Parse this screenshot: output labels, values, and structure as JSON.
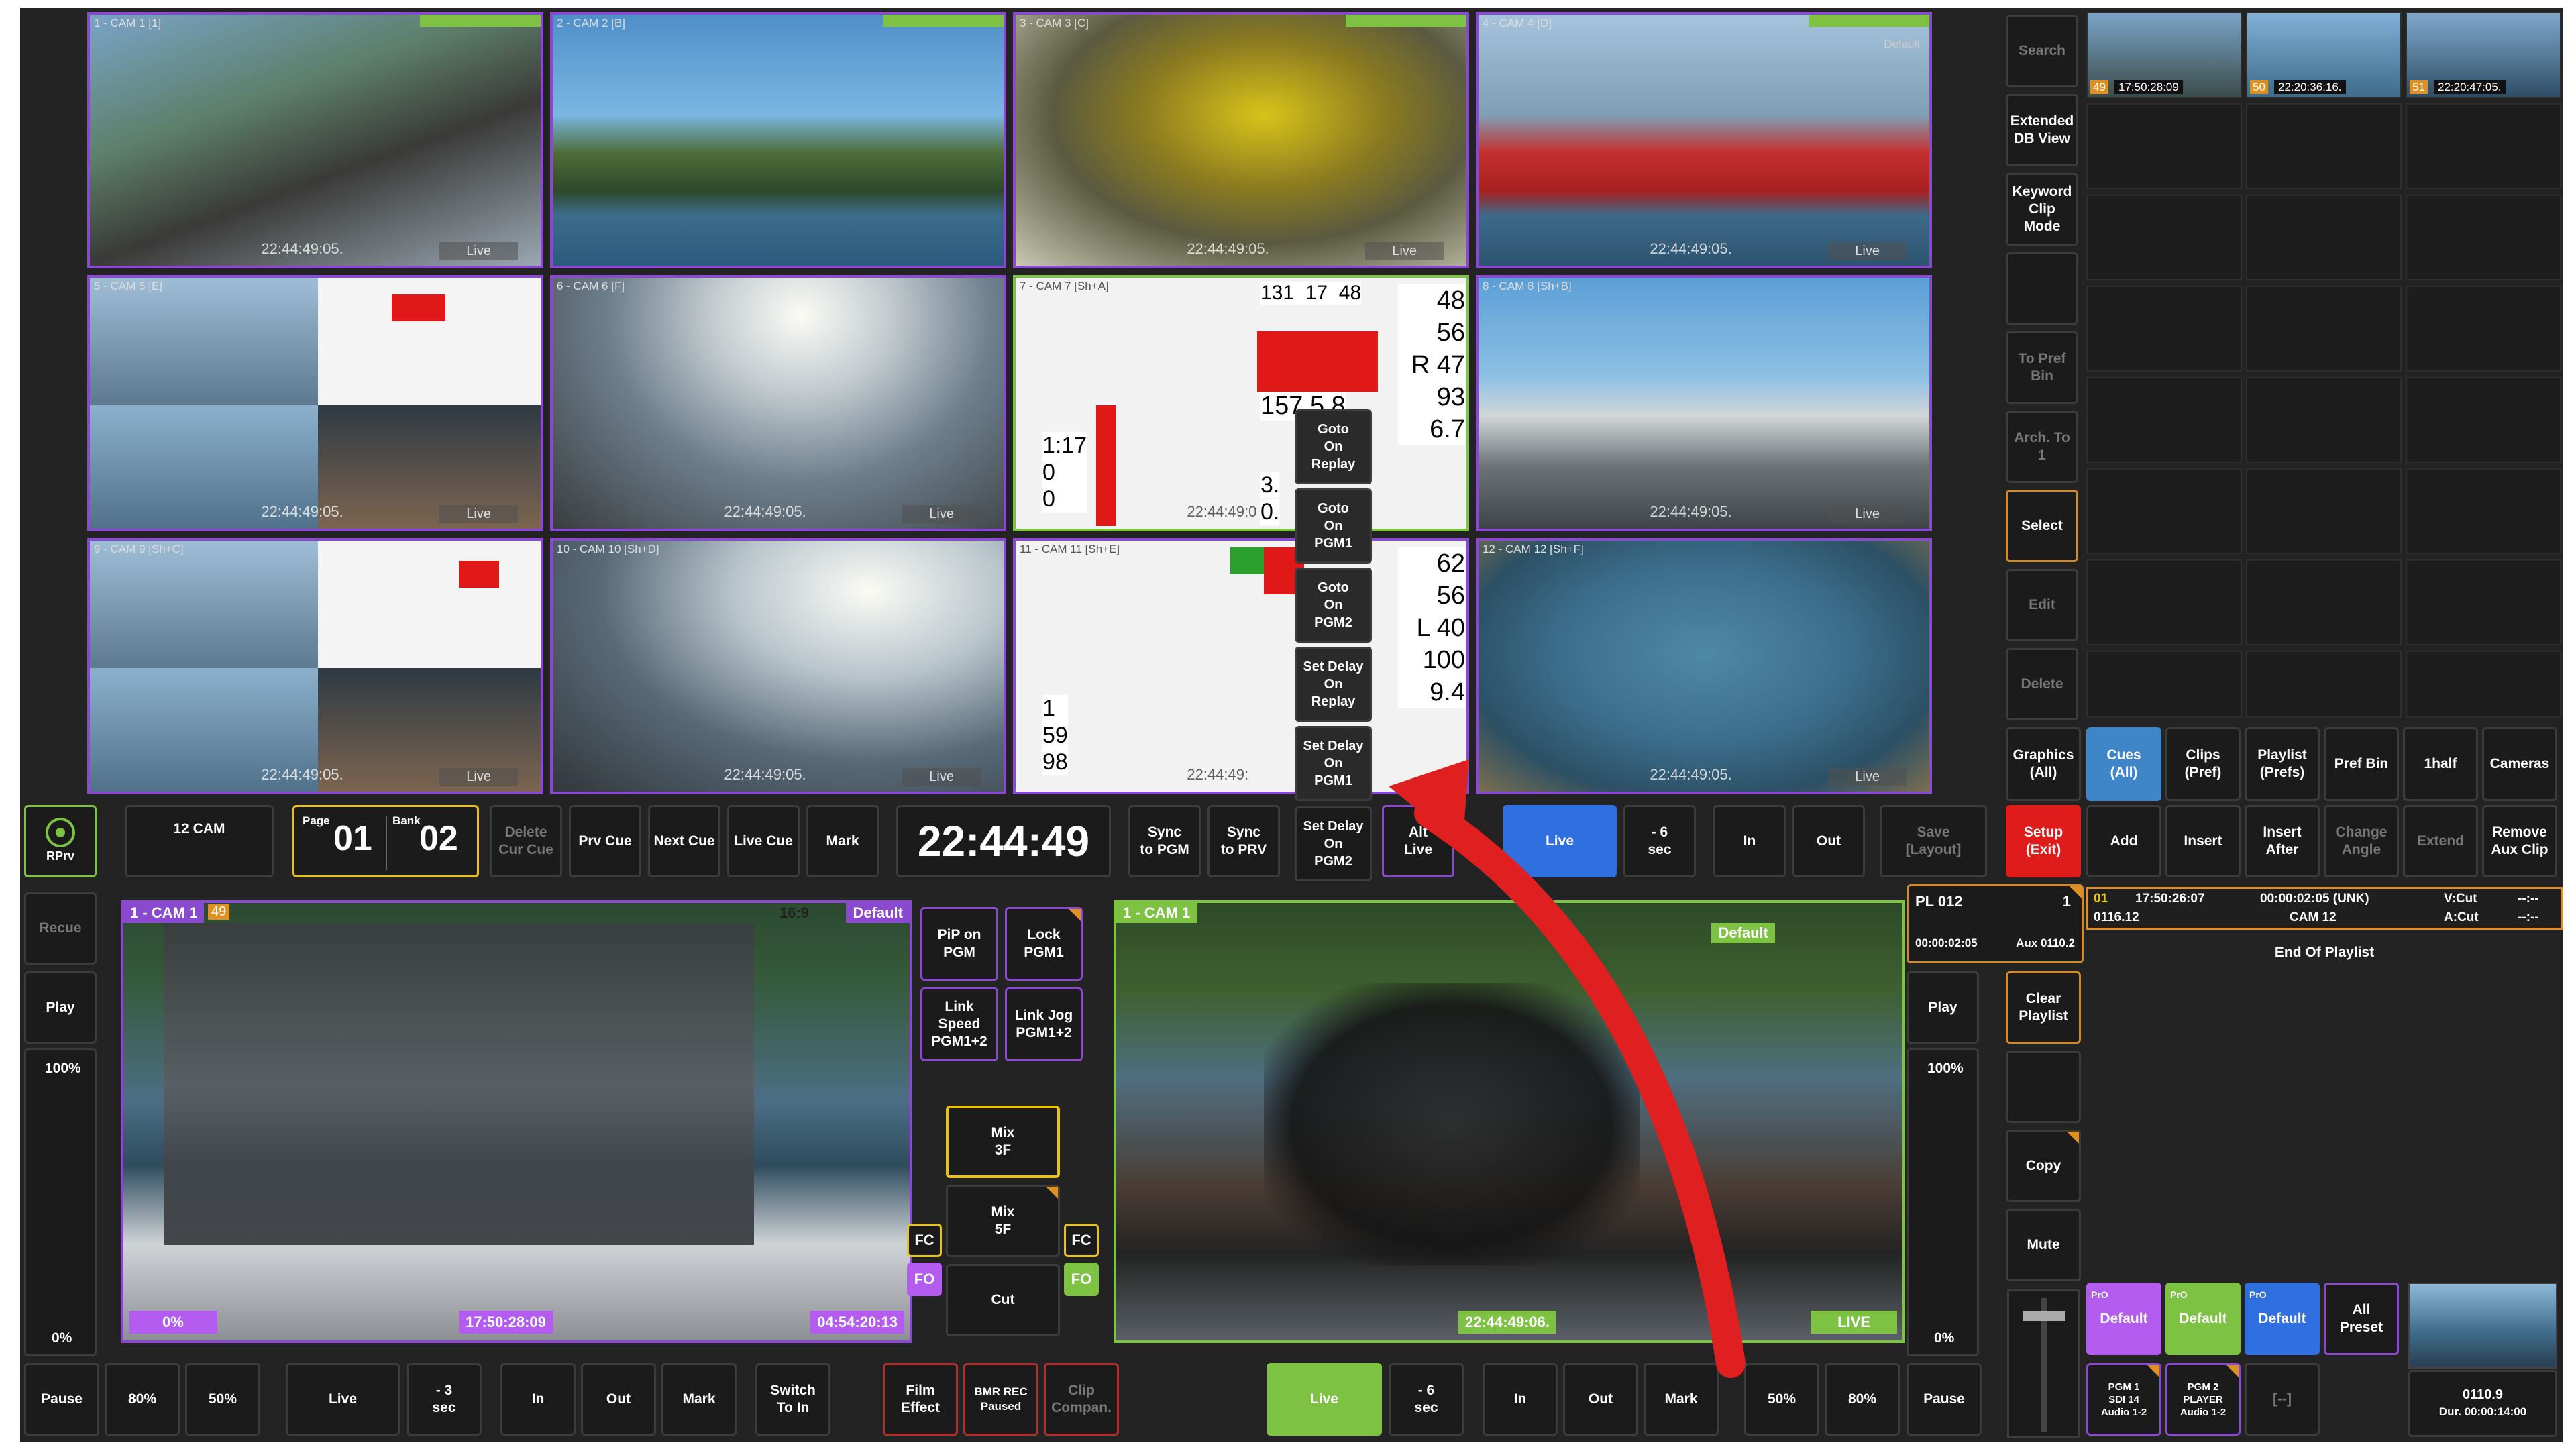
{
  "tiles": [
    {
      "tag": "1 - CAM 1 [1]",
      "tc": "22:44:49:05.",
      "live": "Live"
    },
    {
      "tag": "2 - CAM 2 [B]",
      "tc": "",
      "live": ""
    },
    {
      "tag": "3 - CAM 3 [C]",
      "tc": "22:44:49:05.",
      "live": "Live"
    },
    {
      "tag": "4 - CAM 4 [D]",
      "tc": "22:44:49:05.",
      "live": "Live",
      "preset": "Default"
    },
    {
      "tag": "5 - CAM 5 [E]",
      "tc": "22:44:49:05.",
      "live": "Live"
    },
    {
      "tag": "6 - CAM 6 [F]",
      "tc": "22:44:49:05.",
      "live": "Live"
    },
    {
      "tag": "7 - CAM 7 [Sh+A]",
      "tc": "22:44:49:0",
      "live": ""
    },
    {
      "tag": "8 - CAM 8 [Sh+B]",
      "tc": "22:44:49:05.",
      "live": "Live"
    },
    {
      "tag": "9 - CAM 9 [Sh+C]",
      "tc": "22:44:49:05.",
      "live": "Live"
    },
    {
      "tag": "10 - CAM 10 [Sh+D]",
      "tc": "22:44:49:05.",
      "live": "Live"
    },
    {
      "tag": "11 - CAM 11 [Sh+E]",
      "tc": "22:44:49:",
      "live": ""
    },
    {
      "tag": "12 - CAM 12 [Sh+F]",
      "tc": "22:44:49:05.",
      "live": "Live"
    }
  ],
  "overlay_numbers": {
    "top": [
      "131",
      "17",
      "48"
    ],
    "right": [
      "48",
      "56",
      "R 47",
      "93",
      "6.7",
      "62",
      "56",
      "L 40",
      "100",
      "9.4"
    ],
    "left": [
      "1:17",
      "0",
      "0",
      "1",
      "59",
      "98"
    ],
    "mid": [
      "157",
      "5.8",
      "3.",
      "0."
    ]
  },
  "context_menu": [
    "Goto\nOn\nReplay",
    "Goto\nOn\nPGM1",
    "Goto\nOn\nPGM2",
    "Set Delay\nOn\nReplay",
    "Set Delay\nOn\nPGM1",
    "Set Delay\nOn\nPGM2"
  ],
  "right_top": {
    "search": "Search",
    "ext_db": "Extended\nDB View",
    "keyword": "Keyword\nClip\nMode",
    "to_pref": "To Pref\nBin",
    "arch": "Arch. To\n1",
    "select": "Select",
    "edit": "Edit",
    "delete": "Delete"
  },
  "thumbs": [
    {
      "num": "49",
      "tc": "17:50:28:09"
    },
    {
      "num": "50",
      "tc": "22:20:36:16."
    },
    {
      "num": "51",
      "tc": "22:20:47:05."
    }
  ],
  "bin_tabs": [
    "Graphics\n(All)",
    "Cues\n(All)",
    "Clips\n(Pref)",
    "Playlist\n(Prefs)",
    "Pref Bin",
    "1half",
    "Cameras"
  ],
  "control_row": {
    "rprv": "RPrv",
    "cam": "12 CAM",
    "page_label": "Page",
    "page": "01",
    "bank_label": "Bank",
    "bank": "02",
    "delete_cue": "Delete\nCur Cue",
    "prv_cue": "Prv Cue",
    "next_cue": "Next Cue",
    "live_cue": "Live Cue",
    "mark": "Mark",
    "clock": "22:44:49",
    "sync_pgm": "Sync\nto PGM",
    "sync_prv": "Sync\nto PRV",
    "alt_live": "Alt\nLive",
    "live": "Live",
    "minus6": "- 6\nsec",
    "in": "In",
    "out": "Out",
    "save_layout": "Save\n[Layout]",
    "setup": "Setup\n(Exit)",
    "add": "Add",
    "insert": "Insert",
    "insert_after": "Insert\nAfter",
    "change_angle": "Change\nAngle",
    "extend": "Extend",
    "remove_aux": "Remove\nAux Clip"
  },
  "left_panel": {
    "recue": "Recue",
    "play": "Play",
    "pct_top": "100%",
    "pct_bot": "0%"
  },
  "pgm1": {
    "label": "1 - CAM 1",
    "badge": "49",
    "ratio": "16:9",
    "preset": "Default",
    "speed": "0%",
    "tc_in": "17:50:28:09",
    "tc_out": "04:54:20:13"
  },
  "pgm2": {
    "label": "1 - CAM 1",
    "preset": "Default",
    "tc": "22:44:49:06.",
    "live": "LIVE"
  },
  "center_buttons": {
    "pip": "PiP on\nPGM",
    "lock": "Lock\nPGM1",
    "link_speed": "Link Speed\nPGM1+2",
    "link_jog": "Link Jog\nPGM1+2",
    "mix3": "Mix\n3F",
    "mix5": "Mix\n5F",
    "cut": "Cut",
    "fc": "FC",
    "fo": "FO"
  },
  "playlist": {
    "name": "PL 012",
    "count": "1",
    "dur": "00:00:02:05",
    "aux": "Aux  0110.2",
    "play": "Play",
    "pct_top": "100%",
    "pct_bot": "0%",
    "clear": "Clear\nPlaylist",
    "copy": "Copy",
    "mute": "Mute"
  },
  "playlist_row": {
    "idx": "01",
    "tc": "17:50:26:07",
    "dur": "00:00:02:05 (UNK)",
    "vcut": "V:Cut",
    "id": "0116.12",
    "cam": "CAM 12",
    "acut": "A:Cut",
    "dash1": "--:--",
    "dash2": "--:--",
    "end": "End Of Playlist"
  },
  "presets": [
    {
      "pro": "PrO",
      "label": "Default"
    },
    {
      "pro": "PrO",
      "label": "Default"
    },
    {
      "pro": "PrO",
      "label": "Default"
    }
  ],
  "all_preset": "All\nPreset",
  "outputs": [
    "PGM 1\nSDI 14\nAudio 1-2",
    "PGM 2\nPLAYER\nAudio 1-2",
    "[--]"
  ],
  "clip_info": {
    "id": "0110.9",
    "dur": "Dur. 00:00:14:00"
  },
  "bottom_left": {
    "pause": "Pause",
    "p80": "80%",
    "p50": "50%",
    "live": "Live",
    "minus3": "- 3\nsec",
    "in": "In",
    "out": "Out",
    "mark": "Mark",
    "switch": "Switch\nTo In",
    "film": "Film\nEffect",
    "bmr": "BMR REC\nPaused",
    "clip_comp": "Clip\nCompan."
  },
  "bottom_right": {
    "live": "Live",
    "minus6": "- 6\nsec",
    "in": "In",
    "out": "Out",
    "mark": "Mark",
    "p50": "50%",
    "p80": "80%",
    "pause": "Pause"
  },
  "colors": {
    "accent_purple": "#8a4ad0",
    "live_green": "#7dc243",
    "live_blue": "#2f6fe0",
    "setup_red": "#e01b1b",
    "cue_blue": "#3f86c9",
    "annotation_red": "#e02020"
  }
}
